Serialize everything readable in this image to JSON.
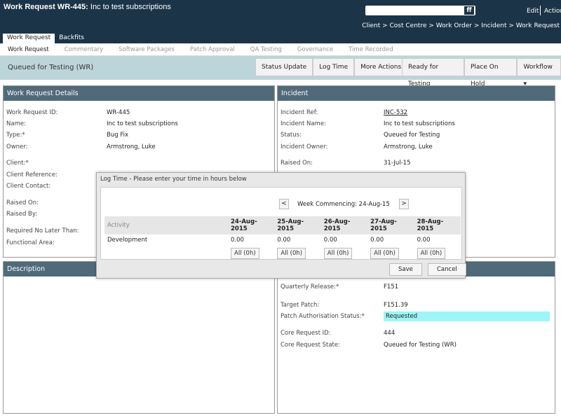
{
  "header": {
    "title_bold": "Work Request WR-445:",
    "title_rest": " Inc to test subscriptions",
    "search_button": "ff",
    "edit": "Edit",
    "action": "Action",
    "breadcrumb": "Client > Cost Centre > Work Order > Incident > Work Request"
  },
  "tabs": [
    "Work Request",
    "Backfits"
  ],
  "subtabs": [
    "Work Request",
    "Commentary",
    "Software Packages",
    "Patch Approval",
    "QA Testing",
    "Governance",
    "Time Recorded"
  ],
  "statusbar": {
    "status": "Queued for Testing (WR)",
    "buttons1": [
      "Status Update",
      "Log Time",
      "More Actions ▾"
    ],
    "buttons2": [
      "Ready for Testing",
      "Place On Hold",
      "Workflow ▾"
    ]
  },
  "details": {
    "title": "Work Request Details",
    "fields": [
      {
        "label": "Work Request ID:",
        "value": "WR-445"
      },
      {
        "label": "Name:",
        "value": "Inc to test subscriptions"
      },
      {
        "label": "Type:*",
        "value": "Bug Fix"
      },
      {
        "label": "Owner:",
        "value": "Armstrong, Luke"
      },
      {
        "label": "Client:*",
        "value": ""
      },
      {
        "label": "Client Reference:",
        "value": ""
      },
      {
        "label": "Client Contact:",
        "value": ""
      },
      {
        "label": "Raised On:",
        "value": ""
      },
      {
        "label": "Raised By:",
        "value": ""
      },
      {
        "label": "Required No Later Than:",
        "value": ""
      },
      {
        "label": "Functional Area:",
        "value": ""
      }
    ]
  },
  "incident": {
    "title": "Incident",
    "fields": [
      {
        "label": "Incident Ref:",
        "value": "INC-532"
      },
      {
        "label": "Incident Name:",
        "value": "Inc to test subscriptions"
      },
      {
        "label": "Status:",
        "value": "Queued for Testing"
      },
      {
        "label": "Incident Owner:",
        "value": "Armstrong, Luke"
      },
      {
        "label": "Raised On:",
        "value": "31-Jul-15"
      }
    ]
  },
  "description": {
    "title": "Description"
  },
  "release": {
    "fields": [
      {
        "label": "Quarterly Release:*",
        "value": "F151"
      },
      {
        "label": "Target Patch:",
        "value": "F151.39"
      },
      {
        "label": "Patch Authorisation Status:*",
        "value": "Requested"
      },
      {
        "label": "Core Request ID:",
        "value": "444"
      },
      {
        "label": "Core Request State:",
        "value": "Queued for Testing (WR)"
      }
    ]
  },
  "dialog": {
    "title": "Log Time - Please enter your time in hours below",
    "prev": "<",
    "next": ">",
    "week": "Week Commencing: 24-Aug-15",
    "activity_header": "Activity",
    "days": [
      "24-Aug-2015",
      "25-Aug-2015",
      "26-Aug-2015",
      "27-Aug-2015",
      "28-Aug-2015"
    ],
    "activity": "Development",
    "hours": [
      "0.00",
      "0.00",
      "0.00",
      "0.00",
      "0.00"
    ],
    "all_label": "All (0h)",
    "save": "Save",
    "cancel": "Cancel"
  }
}
